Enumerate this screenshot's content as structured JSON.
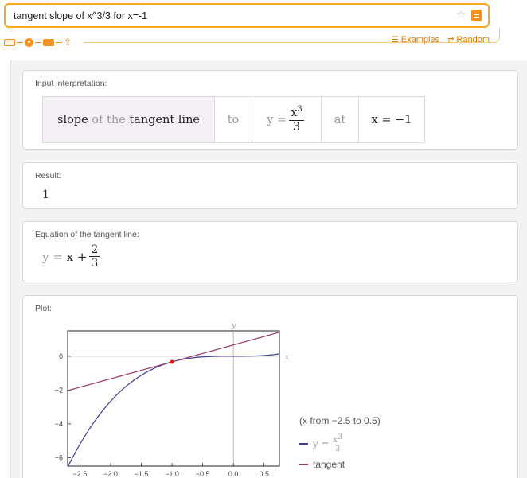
{
  "search": {
    "query": "tangent slope of x^3/3 for x=-1"
  },
  "links": {
    "examples": "Examples",
    "random": "Random"
  },
  "pods": {
    "input": {
      "title": "Input interpretation:",
      "cells": {
        "slope": "slope",
        "of_the": "of the",
        "tangent_line": "tangent line",
        "to": "to",
        "y_eq": "y =",
        "num": "x",
        "num_exp": "3",
        "den": "3",
        "at": "at",
        "x_eq": "x = −1"
      }
    },
    "result": {
      "title": "Result:",
      "value": "1"
    },
    "equation": {
      "title": "Equation of the tangent line:",
      "lhs": "y =",
      "mid": "x +",
      "num": "2",
      "den": "3"
    },
    "plot": {
      "title": "Plot:",
      "range_text": "(x from −2.5 to 0.5)",
      "legend": {
        "curve_prefix": "y =",
        "curve_num": "x",
        "curve_num_exp": "3",
        "curve_den": "3",
        "tangent": "tangent"
      }
    }
  },
  "colors": {
    "accent": "#f6921e",
    "curve": "#3d3e95",
    "tangent": "#9b3a6b",
    "point": "#e01010"
  },
  "chart_data": {
    "type": "line",
    "xlabel": "x",
    "ylabel": "y",
    "xlim": [
      -2.7,
      0.75
    ],
    "ylim": [
      -6.5,
      1.5
    ],
    "x_ticks": [
      -2.5,
      -2.0,
      -1.5,
      -1.0,
      -0.5,
      0.0,
      0.5
    ],
    "x_tick_labels": [
      "−2.5",
      "−2.0",
      "−1.5",
      "−1.0",
      "−0.5",
      "0.0",
      "0.5"
    ],
    "y_ticks": [
      0,
      -2,
      -4,
      -6
    ],
    "y_tick_labels": [
      "0",
      "−2",
      "−4",
      "−6"
    ],
    "series": [
      {
        "name": "y = x³/3",
        "function": "x^3/3",
        "color": "#3d3e95"
      },
      {
        "name": "tangent",
        "function": "x + 2/3",
        "color": "#9b3a6b"
      }
    ],
    "points": [
      {
        "x": -1,
        "y": -0.3333,
        "color": "#e01010"
      }
    ]
  }
}
